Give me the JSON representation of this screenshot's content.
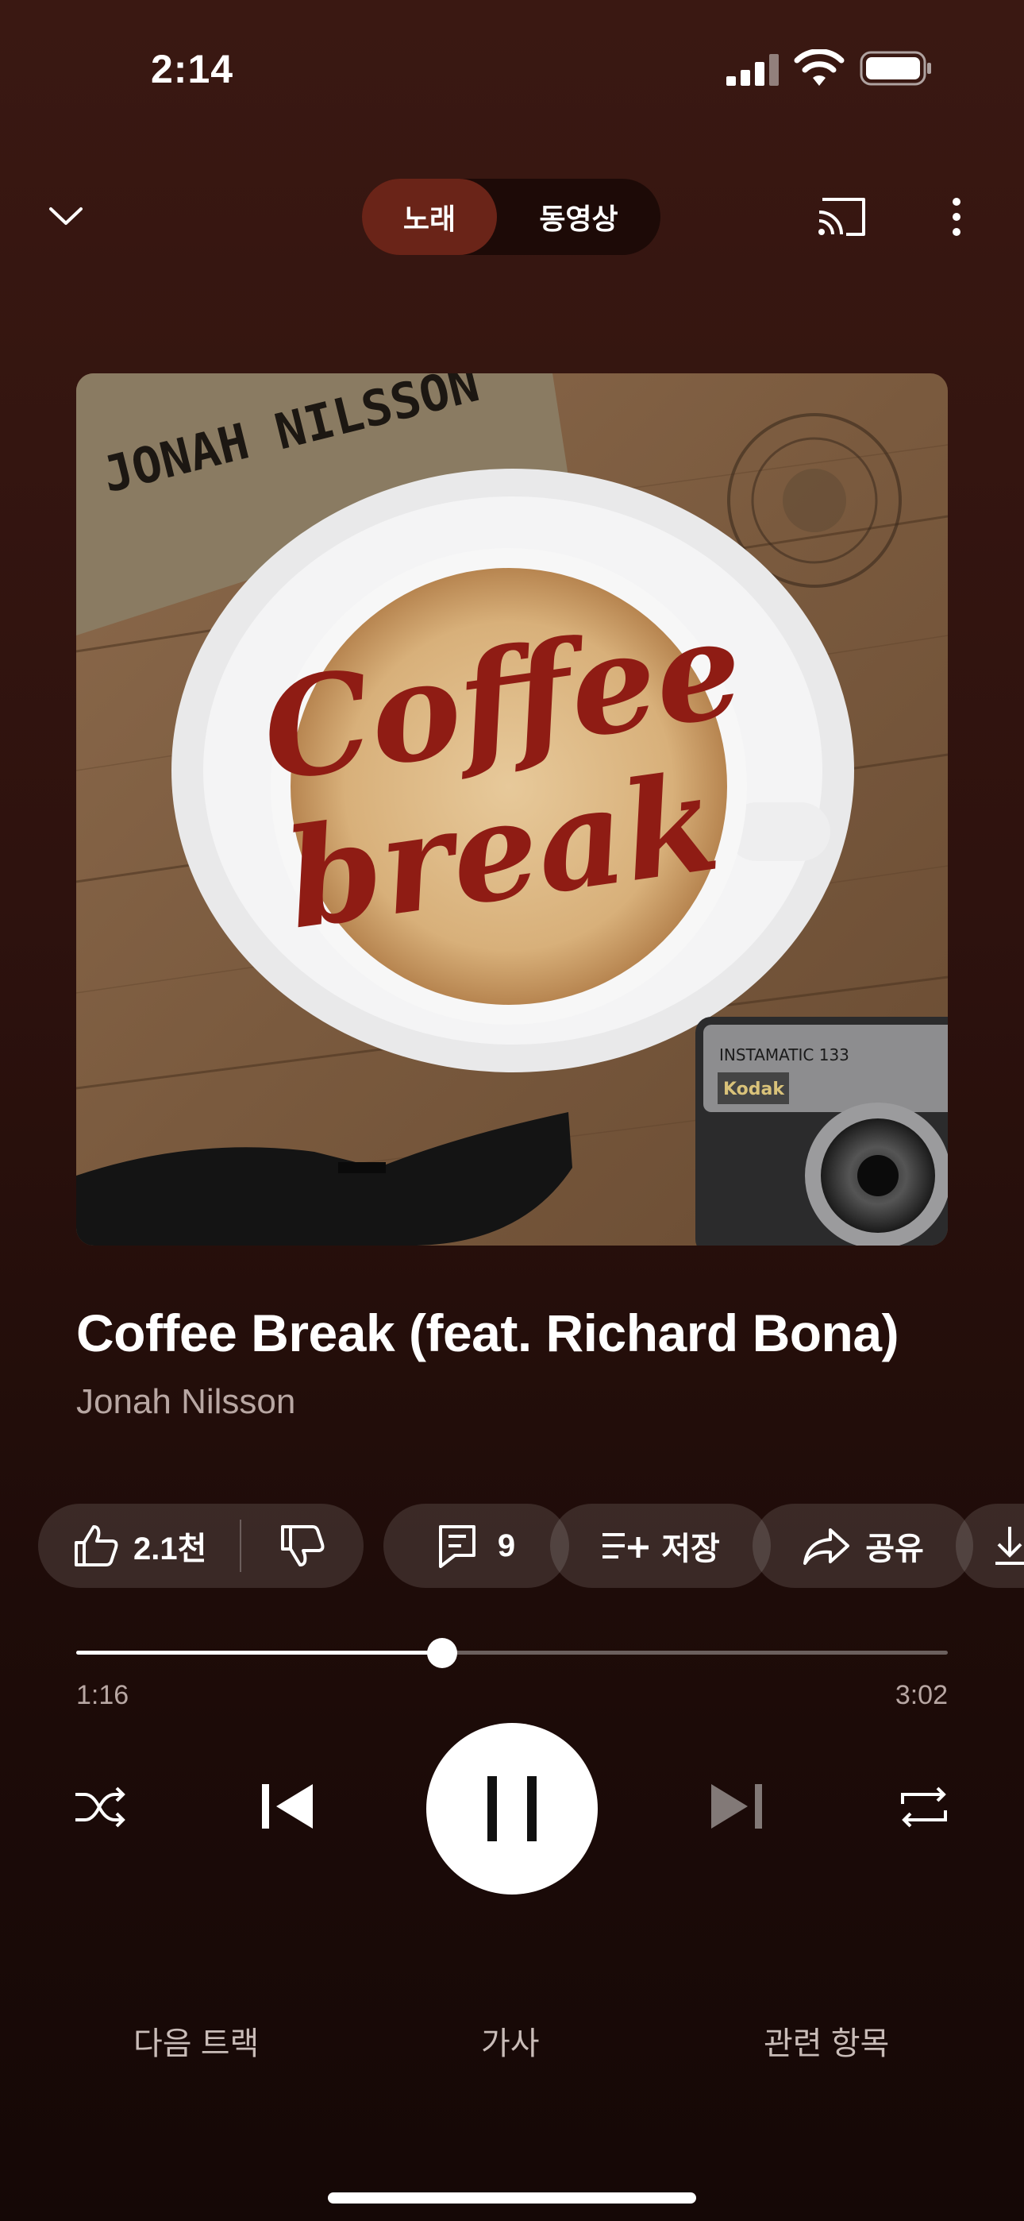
{
  "status_bar": {
    "time": "2:14",
    "signal_icon": "cellular-signal-icon",
    "wifi_icon": "wifi-icon",
    "battery_icon": "battery-icon"
  },
  "top_bar": {
    "tabs": [
      {
        "label": "노래",
        "active": true
      },
      {
        "label": "동영상",
        "active": false
      }
    ]
  },
  "album_art": {
    "artist_text": "JONAH NILSSON",
    "cover_text_line1": "Coffee",
    "cover_text_line2": "break",
    "camera_brand": "Kodak",
    "camera_model": "INSTAMATIC 133"
  },
  "track": {
    "title": "Coffee Break (feat. Richard Bona)",
    "artist": "Jonah Nilsson"
  },
  "actions": {
    "like_count": "2.1천",
    "comment_count": "9",
    "save_label": "저장",
    "share_label": "공유"
  },
  "playback": {
    "elapsed": "1:16",
    "total": "3:02",
    "progress_fraction": 0.42
  },
  "bottom_tabs": {
    "next": "다음 트랙",
    "lyrics": "가사",
    "related": "관련 항목"
  },
  "colors": {
    "background_top": "#3a1812",
    "background_bottom": "#150806",
    "active_segment": "#6a2418",
    "coffee_red": "#8f1c14"
  }
}
